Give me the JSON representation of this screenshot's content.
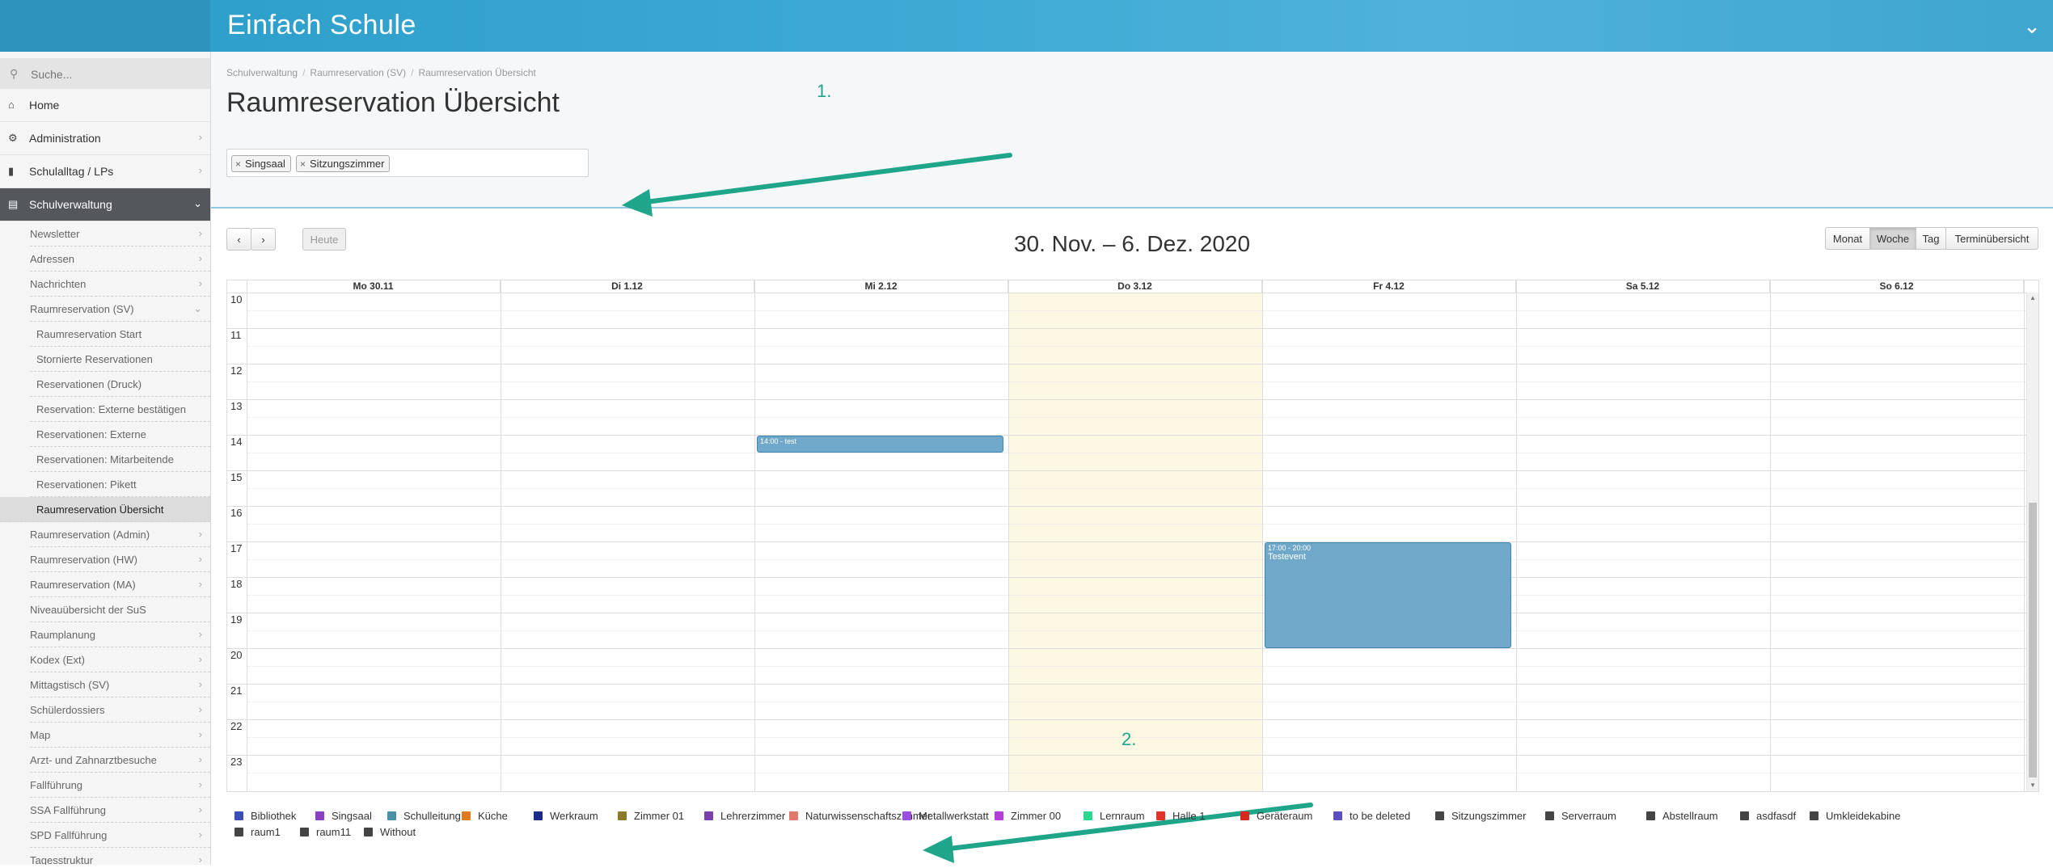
{
  "app": {
    "title": "Einfach Schule"
  },
  "sidebar": {
    "search_placeholder": "Suche...",
    "main_items": [
      {
        "label": "Home",
        "icon": "home-icon"
      },
      {
        "label": "Administration",
        "icon": "gears-icon"
      },
      {
        "label": "Schulalltag / LPs",
        "icon": "bookmark-icon"
      },
      {
        "label": "Schulverwaltung",
        "icon": "folder-open-icon"
      }
    ],
    "sub_items": [
      "Newsletter",
      "Adressen",
      "Nachrichten",
      "Raumreservation (SV)"
    ],
    "sub_sub_items": [
      "Raumreservation Start",
      "Stornierte Reservationen",
      "Reservationen (Druck)",
      "Reservation: Externe bestätigen",
      "Reservationen: Externe",
      "Reservationen: Mitarbeitende",
      "Reservationen: Pikett",
      "Raumreservation Übersicht"
    ],
    "sub_items_after": [
      "Raumreservation (Admin)",
      "Raumreservation (HW)",
      "Raumreservation (MA)",
      "Niveauübersicht der SuS",
      "Raumplanung",
      "Kodex (Ext)",
      "Mittagstisch (SV)",
      "Schülerdossiers",
      "Map",
      "Arzt- und Zahnarztbesuche",
      "Fallführung",
      "SSA Fallführung",
      "SPD Fallführung",
      "Tagesstruktur"
    ]
  },
  "breadcrumb": [
    "Schulverwaltung",
    "Raumreservation (SV)",
    "Raumreservation Übersicht"
  ],
  "page_title": "Raumreservation Übersicht",
  "filter": {
    "tags": [
      "Singsaal",
      "Sitzungszimmer"
    ]
  },
  "annotations": {
    "one": "1.",
    "two": "2."
  },
  "calendar": {
    "prev_icon": "chevron-left-icon",
    "next_icon": "chevron-right-icon",
    "today_label": "Heute",
    "title": "30. Nov. – 6. Dez. 2020",
    "views": [
      "Monat",
      "Woche",
      "Tag",
      "Terminübersicht"
    ],
    "active_view": "Woche",
    "days": [
      "Mo 30.11",
      "Di 1.12",
      "Mi 2.12",
      "Do 3.12",
      "Fr 4.12",
      "Sa 5.12",
      "So 6.12"
    ],
    "today_index": 3,
    "hours": [
      "10",
      "11",
      "12",
      "13",
      "14",
      "15",
      "16",
      "17",
      "18",
      "19",
      "20",
      "21",
      "22",
      "23"
    ],
    "events": [
      {
        "day": 2,
        "start": 14,
        "end": 14.5,
        "time": "14:00 - test",
        "name": ""
      },
      {
        "day": 4,
        "start": 17,
        "end": 20,
        "time": "17:00 - 20:00",
        "name": "Testevent"
      }
    ]
  },
  "legend": [
    {
      "label": "Bibliothek",
      "color": "#3b4fb8"
    },
    {
      "label": "Singsaal",
      "color": "#8a3fc2"
    },
    {
      "label": "Schulleitung",
      "color": "#4a8fa8"
    },
    {
      "label": "Küche",
      "color": "#e07a1f"
    },
    {
      "label": "Werkraum",
      "color": "#1d2a8a"
    },
    {
      "label": "Zimmer 01",
      "color": "#8a7a2a"
    },
    {
      "label": "Lehrerzimmer",
      "color": "#7a3fa8"
    },
    {
      "label": "Naturwissenschaftszimmer",
      "color": "#e07a6a"
    },
    {
      "label": "Metallwerkstatt",
      "color": "#9a4fe0"
    },
    {
      "label": "Zimmer 00",
      "color": "#b43fd8"
    },
    {
      "label": "Lernraum",
      "color": "#2ad890"
    },
    {
      "label": "Halle 1",
      "color": "#e0342a"
    },
    {
      "label": "Geräteraum",
      "color": "#d8281e"
    },
    {
      "label": "to be deleted",
      "color": "#5a4fc2"
    },
    {
      "label": "Sitzungszimmer",
      "color": "#444444"
    },
    {
      "label": "Serverraum",
      "color": "#444444"
    },
    {
      "label": "Abstellraum",
      "color": "#444444"
    },
    {
      "label": "asdfasdf",
      "color": "#444444"
    },
    {
      "label": "Umkleidekabine",
      "color": "#444444"
    },
    {
      "label": "raum1",
      "color": "#444444"
    },
    {
      "label": "raum11",
      "color": "#444444"
    },
    {
      "label": "Without",
      "color": "#444444"
    }
  ]
}
